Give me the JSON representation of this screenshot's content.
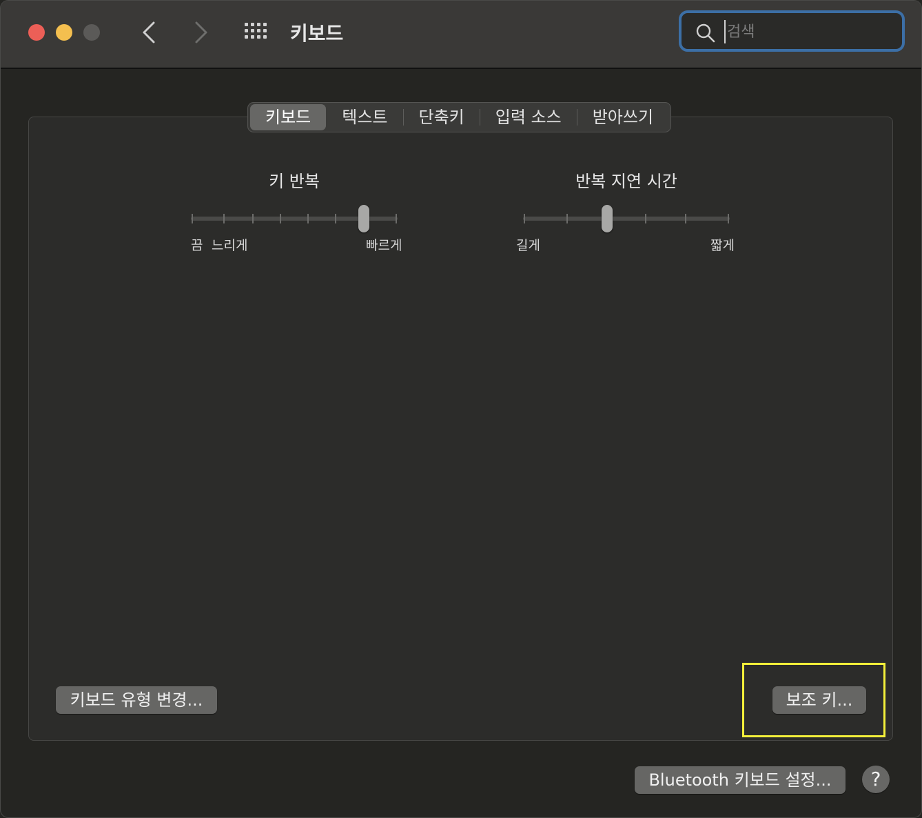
{
  "window": {
    "title": "키보드"
  },
  "toolbar": {
    "back_icon": "chevron-left-icon",
    "forward_icon": "chevron-right-icon",
    "grid_icon": "grid-icon"
  },
  "search": {
    "placeholder": "검색",
    "value": ""
  },
  "tabs": [
    {
      "label": "키보드",
      "active": true
    },
    {
      "label": "텍스트",
      "active": false
    },
    {
      "label": "단축키",
      "active": false
    },
    {
      "label": "입력 소스",
      "active": false
    },
    {
      "label": "받아쓰기",
      "active": false
    }
  ],
  "key_repeat": {
    "title": "키 반복",
    "label_off": "끔",
    "label_slow": "느리게",
    "label_fast": "빠르게",
    "steps": 8,
    "selected_step": 7
  },
  "delay_until_repeat": {
    "title": "반복 지연 시간",
    "label_long": "길게",
    "label_short": "짧게",
    "steps": 6,
    "selected_step": 3
  },
  "buttons": {
    "change_keyboard_type": "키보드 유형 변경...",
    "modifier_keys": "보조 키...",
    "bluetooth_setup": "Bluetooth 키보드 설정...",
    "help": "?"
  },
  "colors": {
    "highlight": "#f4f03a",
    "search_focus_ring": "#3c6fa6",
    "close": "#ec5f57",
    "minimize": "#f4bf4f"
  }
}
